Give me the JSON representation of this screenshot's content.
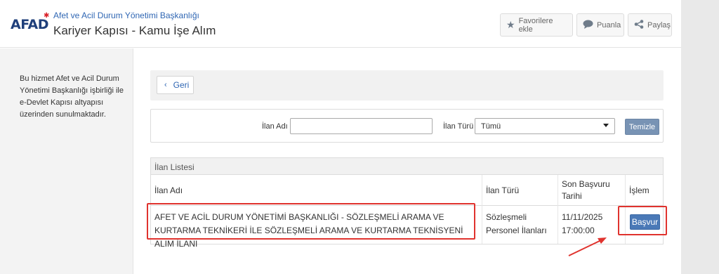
{
  "header": {
    "logo": "AFAD",
    "institution": "Afet ve Acil Durum Yönetimi Başkanlığı",
    "service": "Kariyer Kapısı - Kamu İşe Alım",
    "buttons": {
      "favorite": "Favorilere ekle",
      "rate": "Puanla",
      "share": "Paylaş"
    }
  },
  "sidebar": {
    "info": "Bu hizmet Afet ve Acil Durum Yönetimi Başkanlığı işbirliği ile e-Devlet Kapısı altyapısı üzerinden sunulmaktadır."
  },
  "nav": {
    "back": "Geri"
  },
  "filter": {
    "name_label": "İlan Adı",
    "name_value": "",
    "type_label": "İlan Türü",
    "type_value": "Tümü",
    "clear": "Temizle"
  },
  "list": {
    "title": "İlan Listesi",
    "columns": [
      "İlan Adı",
      "İlan Türü",
      "Son Başvuru Tarihi",
      "İşlem"
    ],
    "rows": [
      {
        "name": "AFET VE ACİL DURUM YÖNETİMİ BAŞKANLIĞI - SÖZLEŞMELİ ARAMA VE KURTARMA TEKNİKERİ İLE SÖZLEŞMELİ ARAMA VE KURTARMA TEKNİSYENİ ALIM İLANI",
        "type": "Sözleşmeli Personel İlanları",
        "deadline": "11/11/2025 17:00:00",
        "action": "Başvur"
      }
    ]
  },
  "colors": {
    "highlight": "#e0332e",
    "primary_button": "#4a79b7",
    "link": "#2f66b3"
  }
}
